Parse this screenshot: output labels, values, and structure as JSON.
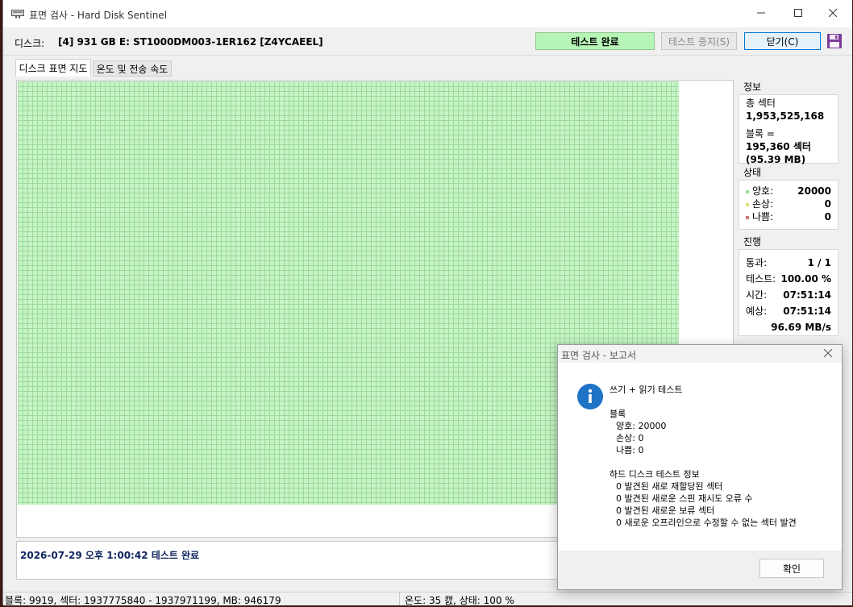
{
  "window": {
    "title": "표면 검사 - Hard Disk Sentinel"
  },
  "topbar": {
    "disk_label": "디스크:",
    "disk_value": "[4] 931 GB E: ST1000DM003-1ER162 [Z4YCAEEL]",
    "status_label": "테스트 완료",
    "stop_label": "테스트 중지(S)",
    "close_label": "닫기(C)"
  },
  "tabs": [
    "디스크 표면 지도",
    "온도 및 전송 속도"
  ],
  "info": {
    "heading": "정보",
    "total_sectors_label": "총 섹터",
    "total_sectors_value": "1,953,525,168",
    "block_label": "블록 =",
    "block_sectors": "195,360 섹터",
    "block_mb": "(95.39 MB)"
  },
  "status": {
    "heading": "상태",
    "good_label": "양호:",
    "good_value": "20000",
    "damaged_label": "손상:",
    "damaged_value": "0",
    "bad_label": "나쁨:",
    "bad_value": "0"
  },
  "progress": {
    "heading": "진행",
    "pass_label": "통과:",
    "pass_value": "1 / 1",
    "test_label": "테스트:",
    "test_value": "100.00 %",
    "time_label": "시간:",
    "time_value": "07:51:14",
    "estimate_label": "예상:",
    "estimate_value": "07:51:14",
    "speed_value": "96.69 MB/s"
  },
  "log": {
    "message": "2026-07-29  오후 1:00:42   테스트 완료"
  },
  "statusbar": {
    "left": "블록: 9919, 섹터: 1937775840 - 1937971199, MB: 946179",
    "right": "온도: 35  캜, 상태: 100 %"
  },
  "dialog": {
    "title": "표면 검사 - 보고서",
    "test_type": "쓰기 + 읽기 테스트",
    "block_heading": "블록",
    "good": "양호: 20000",
    "damaged": "손상: 0",
    "bad": "나쁨: 0",
    "info_heading": "하드 디스크 테스트 정보",
    "info_lines": [
      "0 발견된 새로 재할당된 섹터",
      "0 발견된 새로운 스핀 재시도 오류 수",
      "0 발견된 새로운 보류 섹터",
      "0 새로운 오프라인으로 수정할 수 없는 섹터 발견"
    ],
    "ok_label": "확인"
  },
  "colors": {
    "good": "#c5f5c5",
    "status_ok": "#b7f5b7",
    "info_icon": "#1f73c7"
  },
  "icons": {
    "app": "hard-disk-icon",
    "save": "floppy-disk-icon",
    "dialog": "info-icon"
  }
}
